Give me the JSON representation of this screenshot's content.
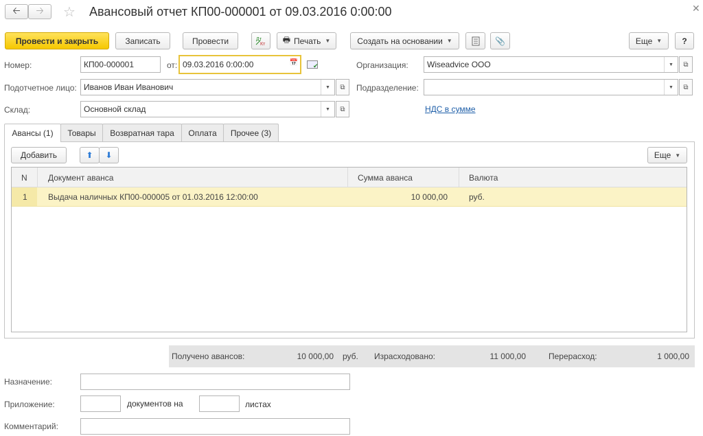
{
  "header": {
    "title": "Авансовый отчет КП00-000001 от 09.03.2016 0:00:00",
    "back_icon": "arrow-left",
    "forward_icon": "arrow-right",
    "favorite_icon": "star",
    "close_icon": "close"
  },
  "toolbar": {
    "post_close": "Провести и закрыть",
    "save": "Записать",
    "post": "Провести",
    "dt_kt_icon": "Дт Кт",
    "print": "Печать",
    "create_based": "Создать на основании",
    "more": "Еще",
    "help": "?"
  },
  "form": {
    "number_label": "Номер:",
    "number_value": "КП00-000001",
    "date_label": "от:",
    "date_value": "09.03.2016  0:00:00",
    "org_label": "Организация:",
    "org_value": "Wiseadvice ООО",
    "person_label": "Подотчетное лицо:",
    "person_value": "Иванов Иван Иванович",
    "division_label": "Подразделение:",
    "division_value": "",
    "warehouse_label": "Склад:",
    "warehouse_value": "Основной склад",
    "vat_link": "НДС в сумме"
  },
  "tabs": [
    {
      "label": "Авансы (1)"
    },
    {
      "label": "Товары"
    },
    {
      "label": "Возвратная тара"
    },
    {
      "label": "Оплата"
    },
    {
      "label": "Прочее (3)"
    }
  ],
  "table_toolbar": {
    "add": "Добавить",
    "more": "Еще"
  },
  "table": {
    "columns": [
      "N",
      "Документ аванса",
      "Сумма аванса",
      "Валюта"
    ],
    "rows": [
      {
        "n": "1",
        "doc": "Выдача наличных КП00-000005 от 01.03.2016 12:00:00",
        "amount": "10 000,00",
        "currency": "руб."
      }
    ]
  },
  "totals": {
    "received_label": "Получено авансов:",
    "received_value": "10 000,00",
    "received_currency": "руб.",
    "spent_label": "Израсходовано:",
    "spent_value": "11 000,00",
    "overspent_label": "Перерасход:",
    "overspent_value": "1 000,00"
  },
  "bottom": {
    "purpose_label": "Назначение:",
    "purpose_value": "",
    "attachment_label": "Приложение:",
    "docs_on": "документов на",
    "sheets": "листах",
    "comment_label": "Комментарий:",
    "comment_value": ""
  },
  "colors": {
    "primary_button": "#f5c800",
    "selected_row": "#fbf3c6",
    "link": "#1d5ea8",
    "date_focus": "#e8c33a"
  }
}
